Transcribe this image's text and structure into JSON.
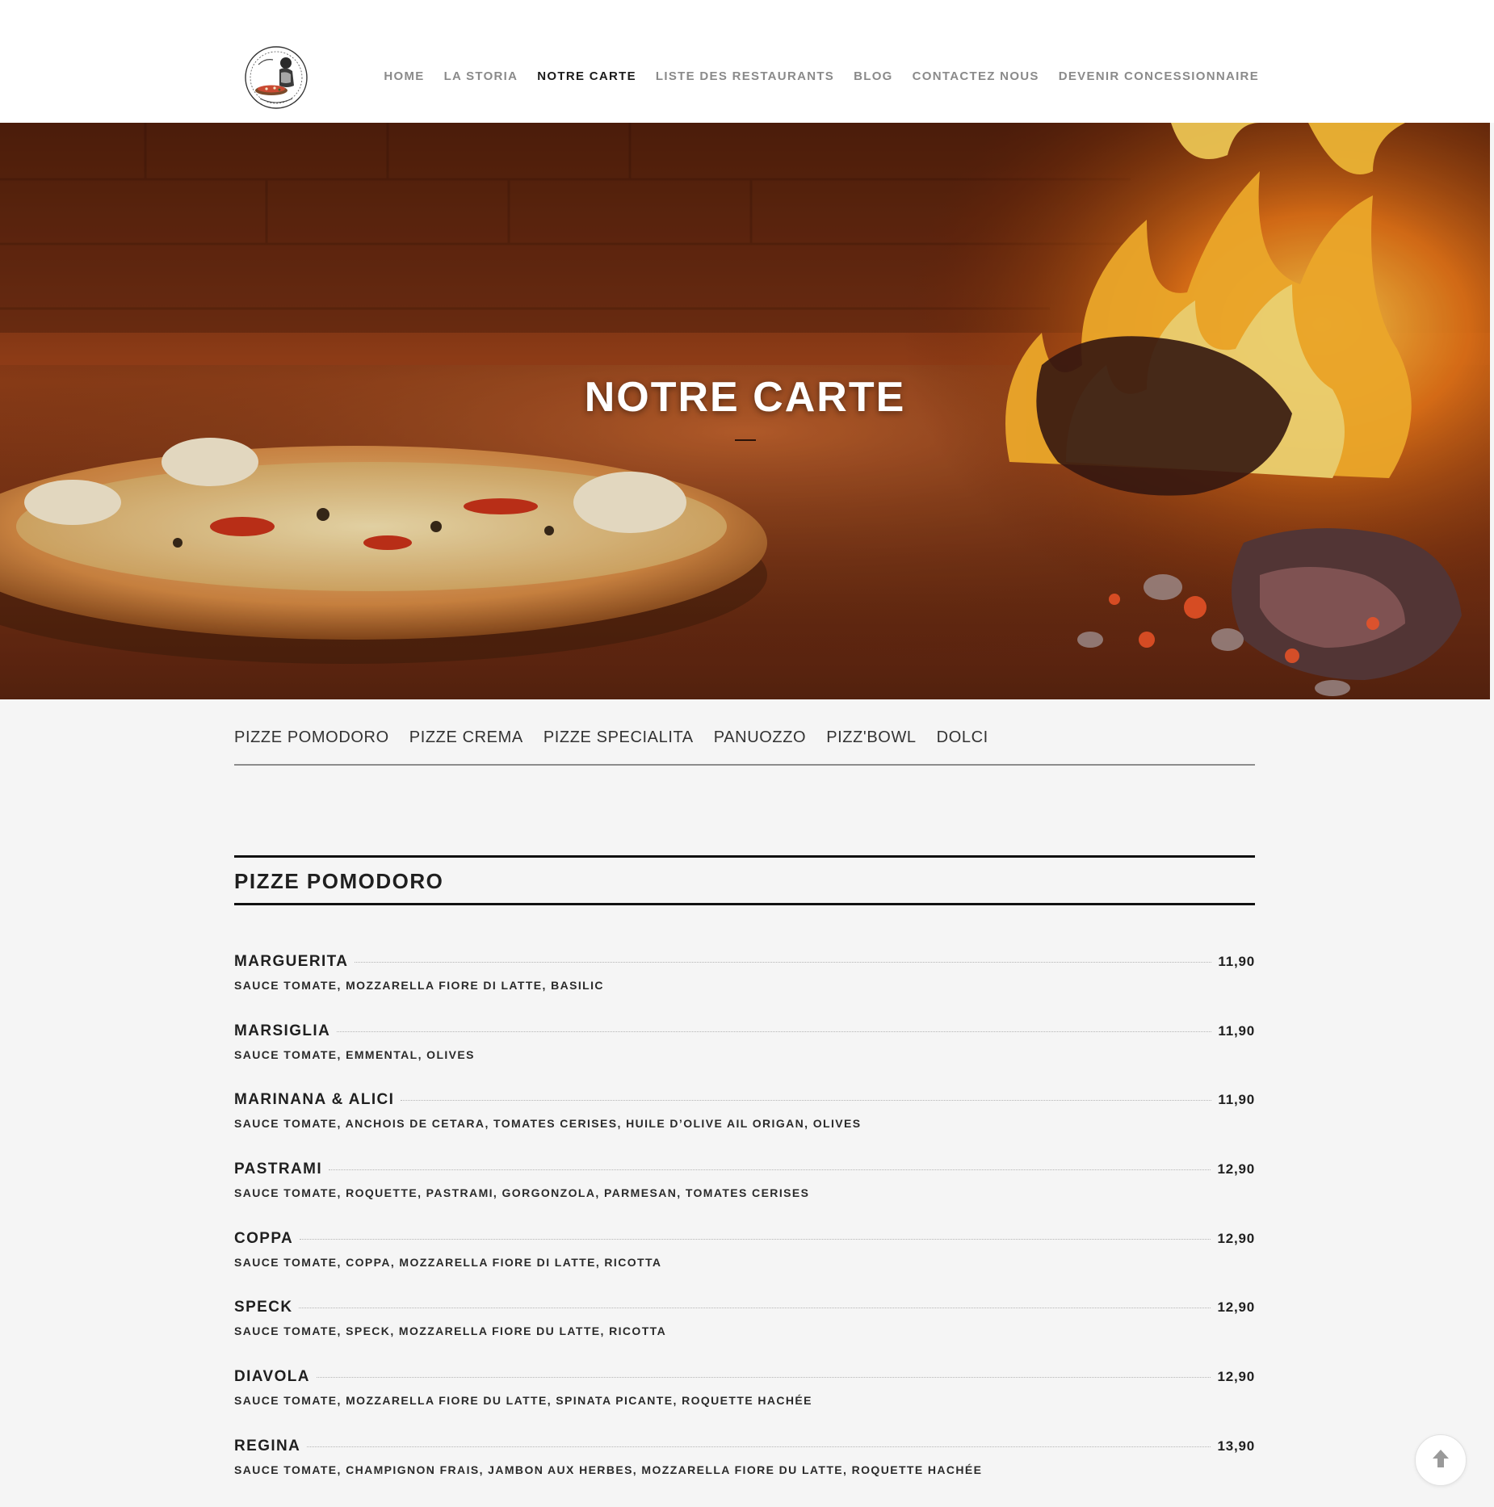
{
  "nav": {
    "items": [
      {
        "label": "HOME"
      },
      {
        "label": "LA STORIA"
      },
      {
        "label": "NOTRE CARTE",
        "active": true
      },
      {
        "label": "LISTE DES RESTAURANTS"
      },
      {
        "label": "BLOG"
      },
      {
        "label": "CONTACTEZ NOUS"
      },
      {
        "label": "DEVENIR CONCESSIONNAIRE"
      }
    ]
  },
  "hero": {
    "title": "NOTRE CARTE"
  },
  "tabs": [
    {
      "label": "PIZZE POMODORO"
    },
    {
      "label": "PIZZE CREMA"
    },
    {
      "label": "PIZZE SPECIALITA"
    },
    {
      "label": "PANUOZZO"
    },
    {
      "label": "PIZZ'BOWL"
    },
    {
      "label": "DOLCI"
    }
  ],
  "section": {
    "title": "PIZZE POMODORO",
    "items": [
      {
        "name": "MARGUERITA",
        "price": "11,90",
        "description": "SAUCE TOMATE, MOZZARELLA FIORE DI LATTE, BASILIC"
      },
      {
        "name": "MARSIGLIA",
        "price": "11,90",
        "description": "SAUCE TOMATE, EMMENTAL, OLIVES"
      },
      {
        "name": "MARINANA & ALICI",
        "price": "11,90",
        "description": "SAUCE TOMATE, ANCHOIS DE CETARA, TOMATES CERISES, HUILE D’OLIVE AIL ORIGAN, OLIVES"
      },
      {
        "name": "PASTRAMI",
        "price": "12,90",
        "description": "SAUCE TOMATE, ROQUETTE, PASTRAMI, GORGONZOLA, PARMESAN, TOMATES CERISES"
      },
      {
        "name": "COPPA",
        "price": "12,90",
        "description": "SAUCE TOMATE, COPPA, MOZZARELLA FIORE DI LATTE, RICOTTA"
      },
      {
        "name": "SPECK",
        "price": "12,90",
        "description": "SAUCE TOMATE, SPECK, MOZZARELLA FIORE DU LATTE, RICOTTA"
      },
      {
        "name": "DIAVOLA",
        "price": "12,90",
        "description": "SAUCE TOMATE, MOZZARELLA FIORE DU LATTE, SPINATA PICANTE, ROQUETTE HACHÉE"
      },
      {
        "name": "REGINA",
        "price": "13,90",
        "description": "SAUCE TOMATE, CHAMPIGNON FRAIS, JAMBON AUX HERBES, MOZZARELLA FIORE DU LATTE, ROQUETTE HACHÉE"
      }
    ]
  },
  "colors": {
    "text": "#1f1f1f",
    "nav_inactive": "#8a8a8a",
    "background": "#f5f5f5"
  },
  "icons": {
    "logo": "pizzeria-logo-badge",
    "scroll_top": "arrow-up-icon"
  }
}
